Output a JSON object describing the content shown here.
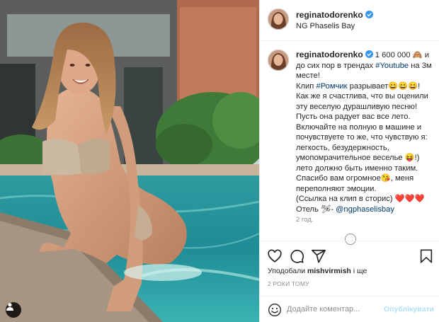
{
  "post": {
    "username": "reginatodorenko",
    "location": "NG Phaselis Bay",
    "caption_lines": [
      "1 600 000 🙈 и до сих пор в трендах ",
      "#Youtube",
      " на 3м месте!",
      "Клип ",
      "#Ромчик",
      " разрывает😄😄😄!",
      "Как же я счастлива, что вы оценили эту веселую дурашливую песню!",
      "Пусть она радует вас все лето.",
      "Включайте на полную в машине и почувствуете то же, что чувствую я: легкость, безудержность, умопомрачительное веселье 😝!)",
      "лето должно быть именно таким.",
      "Спасибо вам огромное😘, меня переполняют эмоции.",
      "(Ссылка на клип в сторис) ❤️❤️❤️",
      "Отель 🛩- ",
      "@ngphaselisbay"
    ],
    "age": "2 год.",
    "more_label": "...",
    "likes_prefix": "Уподобали ",
    "likes_user": "mishvirmish",
    "likes_suffix": " і ще",
    "timestamp": "2 РОКИ ТОМУ",
    "comment_placeholder": "Додайте коментар...",
    "post_label": "Опублікувати"
  },
  "colors": {
    "accent": "#0095f6",
    "link": "#00376b",
    "muted": "#8e8e8e",
    "post_disabled": "#b2dffc"
  },
  "icons": [
    "user-tag-icon",
    "verified-badge-icon",
    "heart-icon",
    "comment-icon",
    "share-icon",
    "bookmark-icon",
    "emoji-icon",
    "more-icon"
  ]
}
